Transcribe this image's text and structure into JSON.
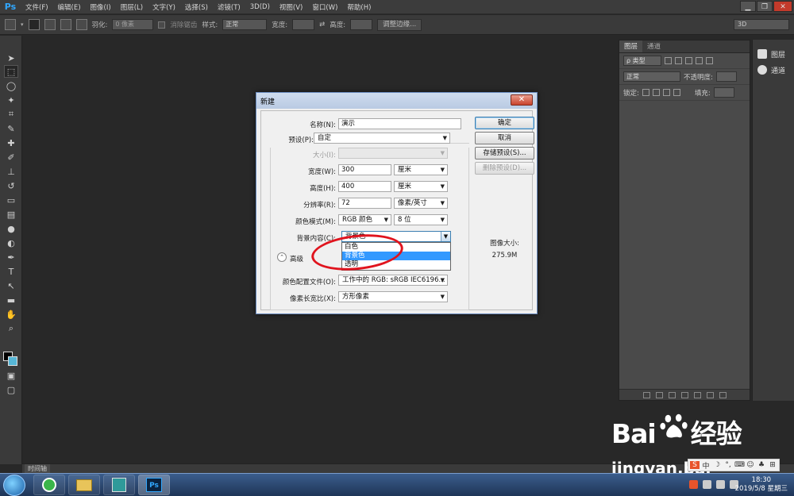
{
  "app": {
    "logo": "Ps"
  },
  "menu": [
    "文件(F)",
    "编辑(E)",
    "图像(I)",
    "图层(L)",
    "文字(Y)",
    "选择(S)",
    "滤镜(T)",
    "3D(D)",
    "视图(V)",
    "窗口(W)",
    "帮助(H)"
  ],
  "options": {
    "feather_label": "羽化:",
    "feather_value": "0 像素",
    "antialias_label": "消除锯齿",
    "style_label": "样式:",
    "style_value": "正常",
    "width_label": "宽度:",
    "height_label": "高度:",
    "refine_button": "调整边缘...",
    "workspace": "3D"
  },
  "panels": {
    "tabs": [
      "图层",
      "通道"
    ],
    "kind_filter": "ρ 类型",
    "blend_mode": "正常",
    "opacity_label": "不透明度:",
    "lock_label": "锁定:",
    "fill_label": "填充:",
    "side_buttons": [
      "图层",
      "通道"
    ]
  },
  "timeline_tab": "时间轴",
  "dialog": {
    "title": "新建",
    "name_label": "名称(N):",
    "name_value": "演示",
    "preset_label": "预设(P):",
    "preset_value": "自定",
    "size_label": "大小(I):",
    "width_label": "宽度(W):",
    "width_value": "300",
    "width_unit": "厘米",
    "height_label": "高度(H):",
    "height_value": "400",
    "height_unit": "厘米",
    "resolution_label": "分辨率(R):",
    "resolution_value": "72",
    "resolution_unit": "像素/英寸",
    "color_mode_label": "颜色模式(M):",
    "color_mode_value": "RGB 颜色",
    "bit_depth": "8 位",
    "bg_content_label": "背景内容(C):",
    "bg_content_value": "背景色",
    "bg_options": [
      "白色",
      "背景色",
      "透明"
    ],
    "bg_selected_index": 1,
    "advanced_label": "高级",
    "profile_label": "颜色配置文件(O):",
    "profile_value": "工作中的 RGB: sRGB IEC6196...",
    "aspect_label": "像素长宽比(X):",
    "aspect_value": "方形像素",
    "buttons": {
      "ok": "确定",
      "cancel": "取消",
      "save_preset": "存储预设(S)...",
      "delete_preset": "删除预设(D)..."
    },
    "image_size_label": "图像大小:",
    "image_size_value": "275.9M"
  },
  "watermark": {
    "logo": "Bai",
    "logo_suffix": "经验",
    "url": "jingyan.bai"
  },
  "taskbar": {
    "time": "18:30",
    "date": "2019/5/8 星期三",
    "ps_label": "Ps"
  },
  "colors": {
    "accent": "#3399ff",
    "highlight_ring": "#e0141e",
    "ps_blue": "#31a8ff",
    "background_swatch": "#56b6d6"
  }
}
